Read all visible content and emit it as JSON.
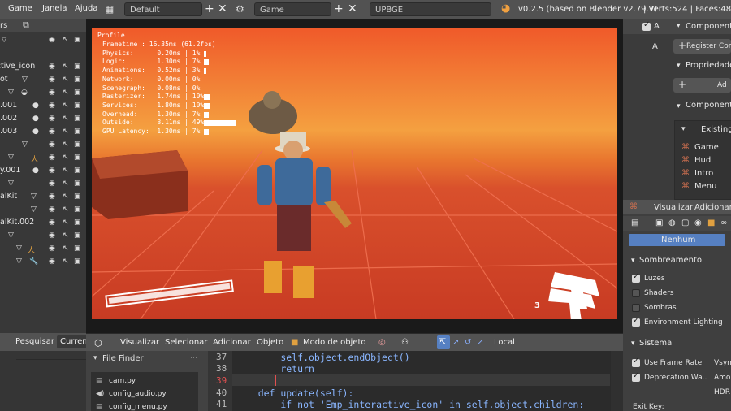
{
  "topbar": {
    "menus": [
      "Game",
      "Janela",
      "Ajuda"
    ],
    "screen_layout": "Default",
    "scene": "Game",
    "engine": "UPBGE",
    "version": "v0.2.5 (based on Blender v2.79.7)",
    "stats": "| Verts:524 | Faces:488"
  },
  "outliner": {
    "header_text": "rs",
    "rows": [
      {
        "label": ""
      },
      {
        "label": "active_icon",
        "prefix": "ract"
      },
      {
        "label": "ot"
      },
      {
        "label": ""
      },
      {
        "label": ".001"
      },
      {
        "label": ".002"
      },
      {
        "label": ".003"
      },
      {
        "label": ""
      },
      {
        "label": ""
      },
      {
        "label": "y.001"
      },
      {
        "label": ""
      },
      {
        "label": "alKit"
      },
      {
        "label": ""
      },
      {
        "label": "alKit.002"
      },
      {
        "label": ""
      },
      {
        "label": ""
      },
      {
        "label": ""
      }
    ],
    "full_labels": {
      "row1": "ractive_icon"
    }
  },
  "profile": {
    "title": "Profile",
    "lines": [
      "Frametime : 16.35ms (61.2fps)",
      "Physics:      0.20ms | 1%",
      "Logic:        1.30ms | 7%",
      "Animations:   0.52ms | 3%",
      "Network:      0.00ms | 0%",
      "Scenegraph:   0.08ms | 0%",
      "Rasterizer:   1.74ms | 10%",
      "Services:     1.80ms | 10%",
      "Overhead:     1.30ms | 7%",
      "Outside:      8.11ms | 49%",
      "GPU Latency:  1.30ms | 7%"
    ],
    "bars": [
      0,
      0.01,
      0.07,
      0.03,
      0,
      0,
      0.1,
      0.1,
      0.07,
      0.49,
      0.07
    ]
  },
  "hud": {
    "ammo": "3"
  },
  "right_top": {
    "components": "Components",
    "register": "Register Com",
    "propriedades": "Propriedades",
    "add": "Ad",
    "component": "Component",
    "existing": "Existing",
    "items": [
      "Game",
      "Hud",
      "Intro",
      "Menu"
    ],
    "a_label": "A",
    "a2_label": "A"
  },
  "right_bottom": {
    "visualizar": "Visualizar",
    "adicionar": "Adicionar",
    "nenhum": "Nenhum",
    "sombreamento": "Sombreamento",
    "luzes": "Luzes",
    "shaders": "Shaders",
    "sombras": "Sombras",
    "env_lighting": "Environment Lighting",
    "sistema": "Sistema",
    "use_frame_rate": "Use Frame Rate",
    "vsync": "Vsyn",
    "deprecation": "Deprecation Wa..",
    "amo": "Amo",
    "hdr": "HDR",
    "exit_key": "Exit Key:"
  },
  "left_bottom": {
    "pesquisar": "Pesquisar",
    "current": "Curren"
  },
  "view_header": {
    "items": [
      "Visualizar",
      "Selecionar",
      "Adicionar",
      "Objeto"
    ],
    "mode": "Modo de objeto",
    "orientation": "Local"
  },
  "file_finder": {
    "title": "File Finder",
    "files": [
      "cam.py",
      "config_audio.py",
      "config_menu.py"
    ]
  },
  "code": {
    "lines": [
      {
        "n": "37",
        "text": "        self.object.endObject()"
      },
      {
        "n": "38",
        "text": "        return"
      },
      {
        "n": "39",
        "text": ""
      },
      {
        "n": "40",
        "text": "    def update(self):"
      },
      {
        "n": "41",
        "text": "        if not 'Emp_interactive_icon' in self.object.children:"
      }
    ]
  },
  "colors": {
    "accent": "#5680c2",
    "keyword": "#7aa6ff",
    "string": "#f0d278",
    "viewport_sky": "#f4a040"
  }
}
